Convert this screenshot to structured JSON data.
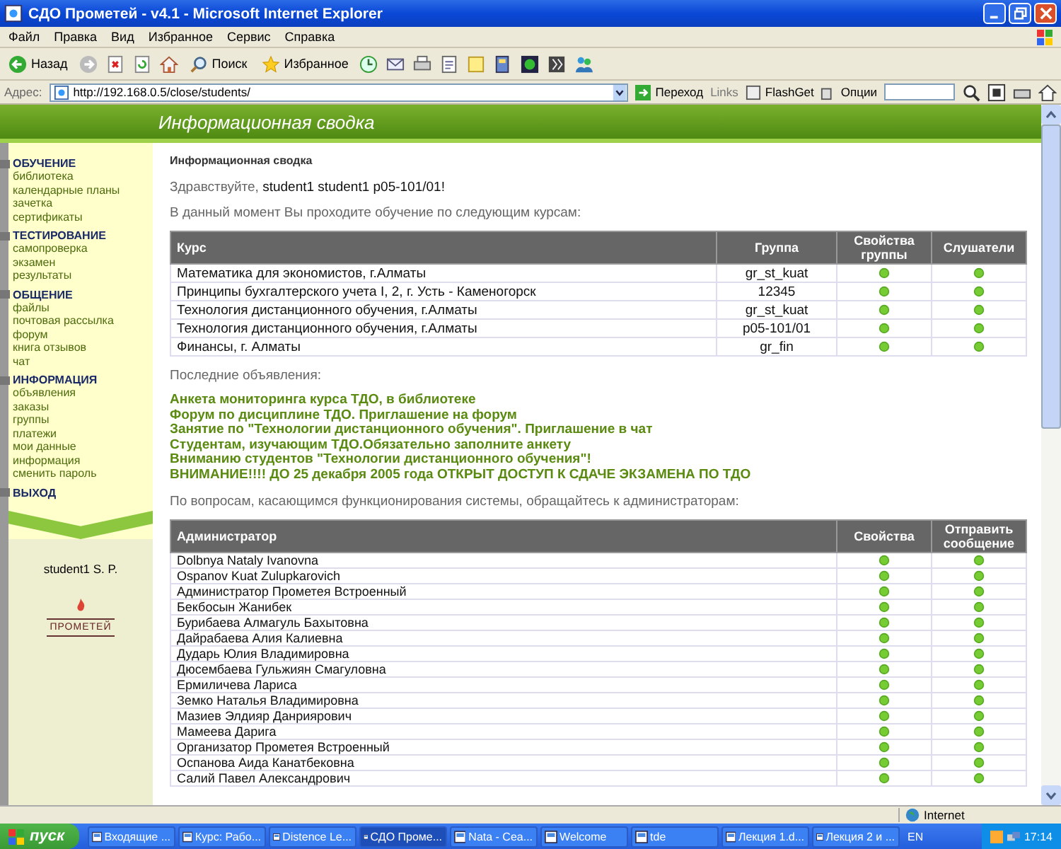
{
  "window": {
    "title": "СДО Прометей - v4.1 - Microsoft Internet Explorer"
  },
  "menu": [
    "Файл",
    "Правка",
    "Вид",
    "Избранное",
    "Сервис",
    "Справка"
  ],
  "toolbar": {
    "back": "Назад",
    "search": "Поиск",
    "favorites": "Избранное"
  },
  "address_bar": {
    "label": "Адрес:",
    "url": "http://192.168.0.5/close/students/",
    "go": "Переход",
    "links": "Links",
    "flashget": "FlashGet",
    "options": "Опции"
  },
  "banner": {
    "title": "Информационная сводка"
  },
  "sidebar": {
    "sections": [
      {
        "title": "ОБУЧЕНИЕ",
        "items": [
          "библиотека",
          "календарные планы",
          "зачетка",
          "сертификаты"
        ]
      },
      {
        "title": "ТЕСТИРОВАНИЕ",
        "items": [
          "самопроверка",
          "экзамен",
          "результаты"
        ]
      },
      {
        "title": "ОБЩЕНИЕ",
        "items": [
          "файлы",
          "почтовая рассылка",
          "форум",
          "книга отзывов",
          "чат"
        ]
      },
      {
        "title": "ИНФОРМАЦИЯ",
        "items": [
          "объявления",
          "заказы",
          "группы",
          "платежи",
          "мои данные",
          "информация",
          "сменить пароль"
        ]
      },
      {
        "title": "ВЫХОД"
      }
    ],
    "user": "student1 S. P.",
    "logo": "ПРОМЕТЕЙ"
  },
  "page": {
    "heading": "Информационная сводка",
    "greeting_prefix": "Здравствуйте,",
    "greeting_name": "student1 student1 p05-101/01!",
    "courses_intro": "В данный момент Вы проходите обучение по следующим курсам:",
    "courses": {
      "columns": [
        "Курс",
        "Группа",
        "Свойства группы",
        "Слушатели"
      ],
      "rows": [
        {
          "course": "Математика для экономистов, г.Алматы",
          "group": "gr_st_kuat"
        },
        {
          "course": "Принципы бухгалтерского учета I, 2, г. Усть - Каменогорск",
          "group": "12345"
        },
        {
          "course": "Технология дистанционного обучения, г.Алматы",
          "group": "gr_st_kuat"
        },
        {
          "course": "Технология дистанционного обучения, г.Алматы",
          "group": "p05-101/01"
        },
        {
          "course": "Финансы, г. Алматы",
          "group": "gr_fin"
        }
      ]
    },
    "announcements_label": "Последние объявления:",
    "announcements": [
      "Анкета мониторинга курса ТДО, в библиотеке",
      "Форум по дисциплине ТДО. Приглашение на форум",
      "Занятие по \"Технологии дистанционного обучения\". Приглашение в чат",
      "Студентам, изучающим ТДО.Обязательно заполните анкету",
      "Вниманию студентов \"Технологии дистанционного обучения\"!",
      "ВНИМАНИЕ!!!! ДО 25 декабря 2005 года ОТКРЫТ ДОСТУП К СДАЧЕ ЭКЗАМЕНА ПО ТДО"
    ],
    "admin_intro": "По вопросам, касающимся функционирования системы, обращайтесь к администраторам:",
    "admins": {
      "columns": [
        "Администратор",
        "Свойства",
        "Отправить сообщение"
      ],
      "rows": [
        "Dolbnya Nataly Ivanovna",
        "Ospanov Kuat Zulupkarovich",
        "Администратор Прометея Встроенный",
        "Бекбосын Жанибек",
        "Бурибаева Алмагуль Бахытовна",
        "Дайрабаева Алия Калиевна",
        "Дударь Юлия Владимировна",
        "Дюсембаева Гульжиян Смагуловна",
        "Ермиличева Лариса",
        "Земко Наталья Владимировна",
        "Мазиев Элдияр Данриярович",
        "Мамеева Дарига",
        "Организатор Прометея Встроенный",
        "Оспанова Аида Канатбековна",
        "Салий Павел Александрович"
      ]
    }
  },
  "status_bar": {
    "zone": "Internet"
  },
  "taskbar": {
    "start": "пуск",
    "tasks": [
      {
        "label": "Входящие ...",
        "selected": false
      },
      {
        "label": "Курс: Рабо...",
        "selected": false
      },
      {
        "label": "Distence Le...",
        "selected": false
      },
      {
        "label": "СДО Проме...",
        "selected": true
      },
      {
        "label": "Nata - Сеа...",
        "selected": false
      },
      {
        "label": "Welcome",
        "selected": false
      },
      {
        "label": "tde",
        "selected": false
      },
      {
        "label": "Лекция 1.d...",
        "selected": false
      },
      {
        "label": "Лекция 2 и ...",
        "selected": false
      }
    ],
    "language": "EN",
    "clock": "17:14"
  }
}
